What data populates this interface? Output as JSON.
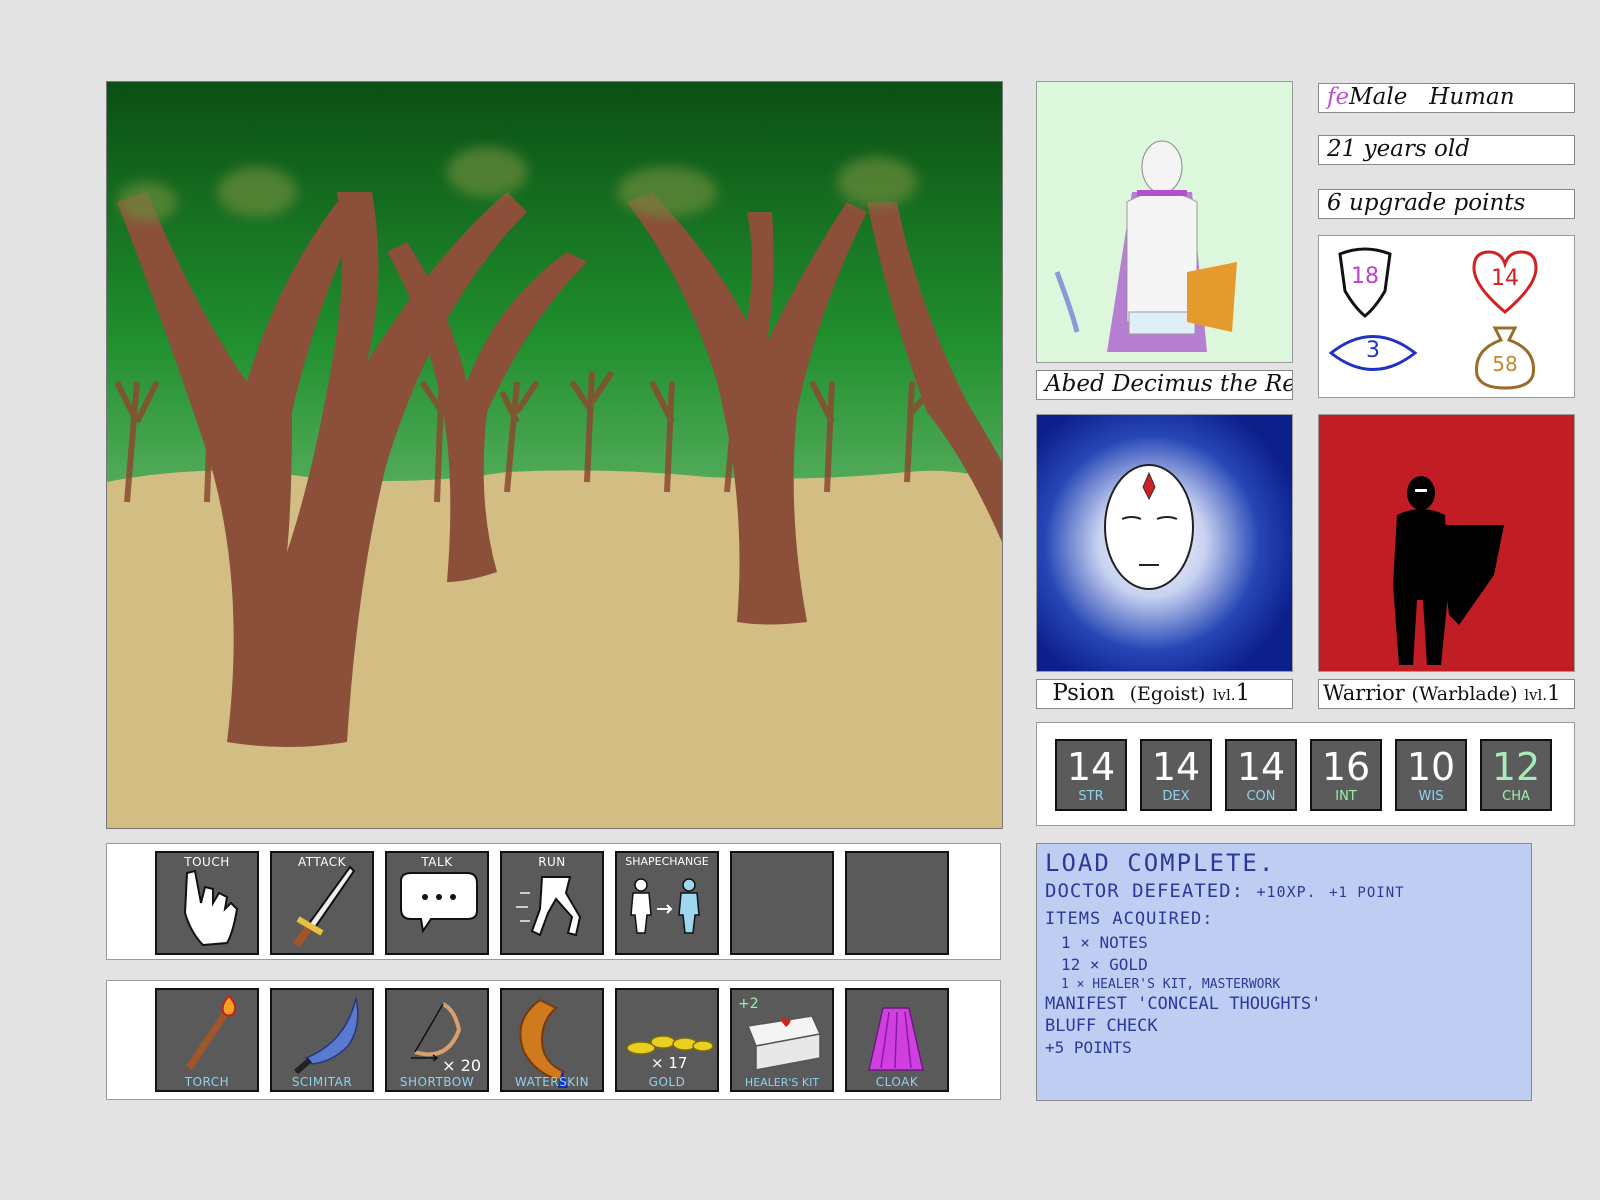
{
  "character": {
    "sex_prefix": "fe",
    "sex": "Male",
    "race": "Human",
    "age_text": "21 years old",
    "upgrade_text": "6 upgrade points",
    "name": "Abed Decimus the Red",
    "stats_box": {
      "armor": "18",
      "health": "14",
      "perception": "3",
      "gold": "58"
    }
  },
  "classes": [
    {
      "name": "Psion",
      "sub": "(Egoist)",
      "level_label": "lvl.",
      "level": "1"
    },
    {
      "name": "Warrior",
      "sub": "(Warblade)",
      "level_label": "lvl.",
      "level": "1"
    }
  ],
  "abilities": [
    {
      "key": "STR",
      "value": "14"
    },
    {
      "key": "DEX",
      "value": "14"
    },
    {
      "key": "CON",
      "value": "14"
    },
    {
      "key": "INT",
      "value": "16"
    },
    {
      "key": "WIS",
      "value": "10"
    },
    {
      "key": "CHA",
      "value": "12"
    }
  ],
  "actions": [
    {
      "label": "TOUCH",
      "icon": "hand-pointer-icon"
    },
    {
      "label": "ATTACK",
      "icon": "sword-icon"
    },
    {
      "label": "TALK",
      "icon": "speech-bubble-icon"
    },
    {
      "label": "RUN",
      "icon": "running-legs-icon"
    },
    {
      "label": "SHAPECHANGE",
      "icon": "shapechange-icon"
    },
    {
      "label": "",
      "icon": ""
    },
    {
      "label": "",
      "icon": ""
    }
  ],
  "inventory": [
    {
      "label": "TORCH",
      "icon": "torch-icon",
      "qty": ""
    },
    {
      "label": "SCIMITAR",
      "icon": "scimitar-icon",
      "qty": ""
    },
    {
      "label": "SHORTBOW",
      "icon": "bow-icon",
      "qty": "× 20"
    },
    {
      "label": "WATERSKIN",
      "icon": "waterskin-icon",
      "qty": ""
    },
    {
      "label": "GOLD",
      "icon": "gold-coins-icon",
      "qty": "× 17"
    },
    {
      "label": "HEALER'S KIT",
      "icon": "healers-kit-icon",
      "qty": "+2"
    },
    {
      "label": "CLOAK",
      "icon": "cloak-icon",
      "qty": ""
    }
  ],
  "log": {
    "line1": "LOAD COMPLETE.",
    "line2_main": "DOCTOR DEFEATED:",
    "line2_xp": "+10XP.",
    "line2_pt": "+1 POINT",
    "line3": "ITEMS ACQUIRED:",
    "items": [
      "1 × NOTES",
      "12 × GOLD",
      "1 × HEALER'S KIT, MASTERWORK"
    ],
    "line4": "MANIFEST 'CONCEAL THOUGHTS'",
    "line5": "BLUFF CHECK",
    "line6": "+5 POINTS"
  },
  "colors": {
    "psion_bg": "#1a3aa8",
    "warrior_bg": "#c11d25",
    "log_bg": "#c0cdf3",
    "slot_bg": "#5a5a5a"
  }
}
